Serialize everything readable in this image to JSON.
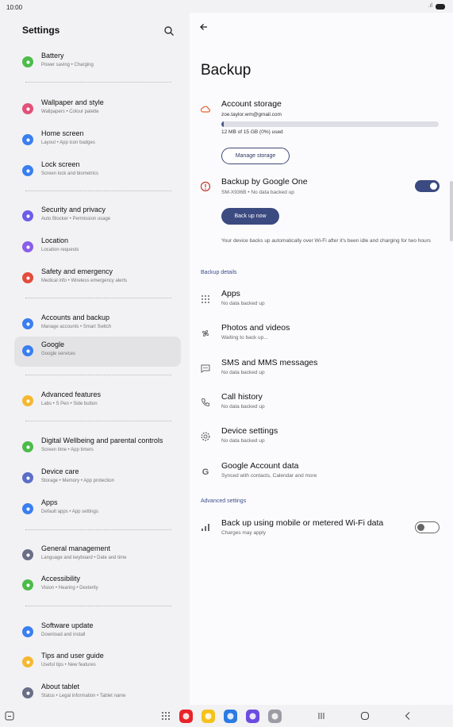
{
  "status_bar": {
    "time": "10:00",
    "signal": ".ıl"
  },
  "left": {
    "title": "Settings",
    "items": [
      {
        "title": "Battery",
        "sub": "Power saving  •  Charging",
        "color": "#4cbb4a",
        "icon": "battery-icon"
      },
      {
        "title": "Wallpaper and style",
        "sub": "Wallpapers  •  Colour palette",
        "color": "#e2517a",
        "icon": "wallpaper-icon"
      },
      {
        "title": "Home screen",
        "sub": "Layout  •  App icon badges",
        "color": "#3a7ff0",
        "icon": "home-icon"
      },
      {
        "title": "Lock screen",
        "sub": "Screen lock and biometrics",
        "color": "#3a7ff0",
        "icon": "lock-icon"
      },
      {
        "title": "Security and privacy",
        "sub": "Auto Blocker  •  Permission usage",
        "color": "#6d5ee8",
        "icon": "shield-icon"
      },
      {
        "title": "Location",
        "sub": "Location requests",
        "color": "#8a5ee8",
        "icon": "location-pin-icon"
      },
      {
        "title": "Safety and emergency",
        "sub": "Medical info  •  Wireless emergency alerts",
        "color": "#e44b3c",
        "icon": "alert-icon"
      },
      {
        "title": "Accounts and backup",
        "sub": "Manage accounts  •  Smart Switch",
        "color": "#3a7ff0",
        "icon": "sync-icon"
      },
      {
        "title": "Google",
        "sub": "Google services",
        "color": "#3a7ff0",
        "icon": "google-icon"
      },
      {
        "title": "Advanced features",
        "sub": "Labs  •  S Pen  •  Side button",
        "color": "#f4b830",
        "icon": "star-icon"
      },
      {
        "title": "Digital Wellbeing and parental controls",
        "sub": "Screen time  •  App timers",
        "color": "#4cbb4a",
        "icon": "wellbeing-icon"
      },
      {
        "title": "Device care",
        "sub": "Storage  •  Memory  •  App protection",
        "color": "#5b6ec7",
        "icon": "device-care-icon"
      },
      {
        "title": "Apps",
        "sub": "Default apps  •  App settings",
        "color": "#3a7ff0",
        "icon": "apps-grid-icon"
      },
      {
        "title": "General management",
        "sub": "Language and keyboard  •  Date and time",
        "color": "#6a6e86",
        "icon": "sliders-icon"
      },
      {
        "title": "Accessibility",
        "sub": "Vision  •  Hearing  •  Dexterity",
        "color": "#4cbb4a",
        "icon": "accessibility-icon"
      },
      {
        "title": "Software update",
        "sub": "Download and install",
        "color": "#3a7ff0",
        "icon": "update-icon"
      },
      {
        "title": "Tips and user guide",
        "sub": "Useful tips  •  New features",
        "color": "#f4b830",
        "icon": "bulb-icon"
      },
      {
        "title": "About tablet",
        "sub": "Status  •  Legal information  •  Tablet name",
        "color": "#6a6e86",
        "icon": "info-icon"
      }
    ]
  },
  "right": {
    "title": "Backup",
    "account_storage": {
      "title": "Account storage",
      "email": "zoe.taylor.wm@gmail.com",
      "usage": "12 MB of 15 GB (0%) used",
      "used_fraction": 0.01,
      "manage_label": "Manage storage"
    },
    "backup_google_one": {
      "title": "Backup by Google One",
      "sub": "SM-X936B • No data backed up",
      "enabled": true,
      "backup_now_label": "Back up now",
      "description": "Your device backs up automatically over Wi-Fi after it's been idle and charging for two hours"
    },
    "details_header": "Backup details",
    "details": [
      {
        "title": "Apps",
        "sub": "No data backed up",
        "icon": "apps-dots-icon"
      },
      {
        "title": "Photos and videos",
        "sub": "Waiting to back up...",
        "icon": "pinwheel-icon"
      },
      {
        "title": "SMS and MMS messages",
        "sub": "No data backed up",
        "icon": "message-icon"
      },
      {
        "title": "Call history",
        "sub": "No data backed up",
        "icon": "phone-icon"
      },
      {
        "title": "Device settings",
        "sub": "No data backed up",
        "icon": "gear-icon"
      },
      {
        "title": "Google Account data",
        "sub": "Synced with contacts, Calendar and more",
        "icon": "google-g-icon"
      }
    ],
    "advanced_header": "Advanced settings",
    "mobile_data": {
      "title": "Back up using mobile or metered Wi-Fi data",
      "sub": "Charges may apply",
      "enabled": false
    }
  },
  "navbar": {
    "apps": [
      {
        "name": "flipboard-app",
        "color": "#e8222a"
      },
      {
        "name": "my-files-app",
        "color": "#f5c21b"
      },
      {
        "name": "messages-app",
        "color": "#2a7be4"
      },
      {
        "name": "internet-app",
        "color": "#6b4be0"
      },
      {
        "name": "camera-app",
        "color": "#9c9ca4"
      }
    ]
  }
}
